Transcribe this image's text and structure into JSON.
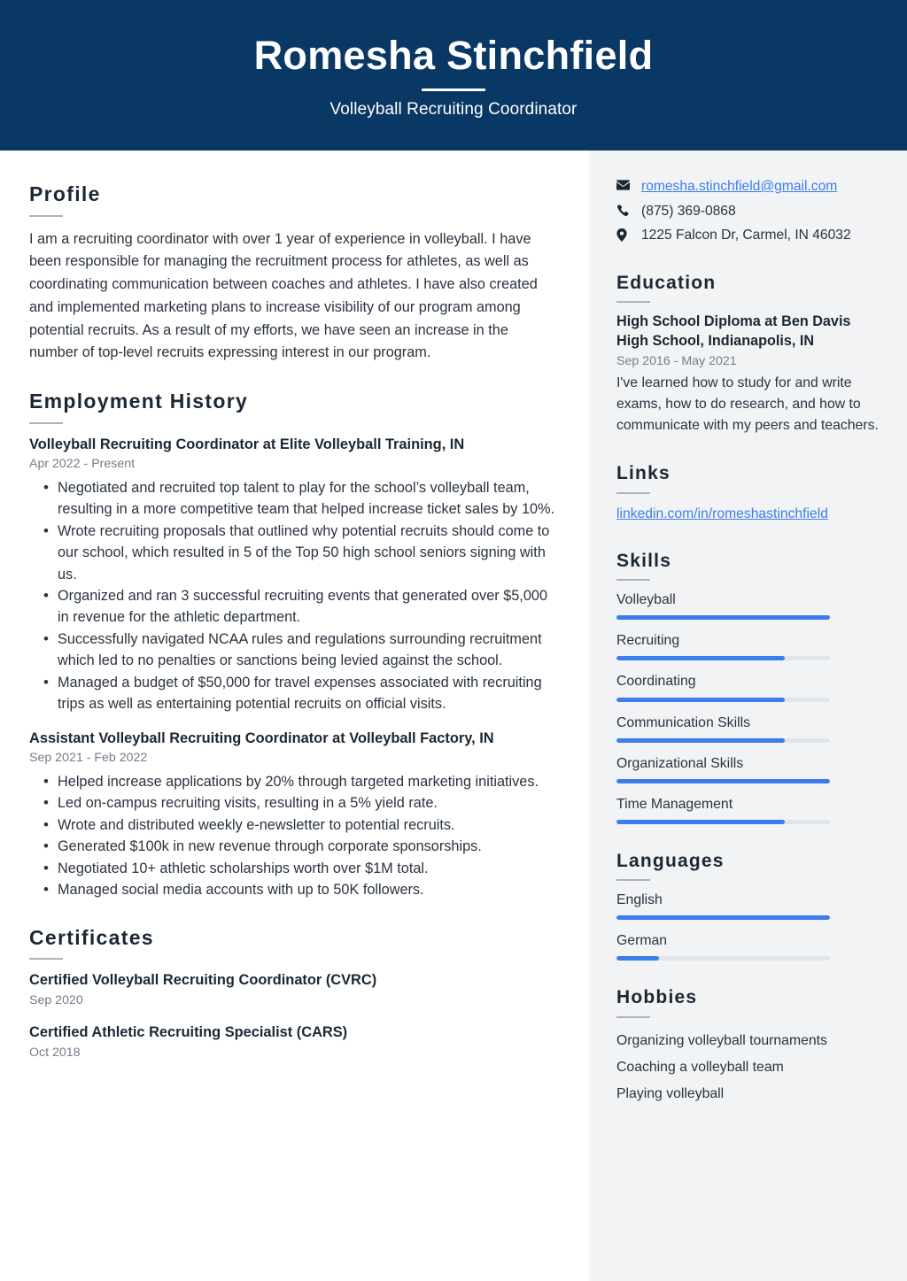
{
  "header": {
    "full_name": "Romesha Stinchfield",
    "job_title": "Volleyball Recruiting Coordinator",
    "background_color": "#0a3865",
    "text_color": "#ffffff"
  },
  "theme": {
    "accent_color": "#3b7ded",
    "sidebar_background": "#f1f3f5",
    "heading_color": "#1b2733",
    "body_text_color": "#2a3340",
    "muted_text_color": "#737d8a",
    "rule_color": "#aeb4bd",
    "track_color": "#e2e5e8"
  },
  "main": {
    "profile": {
      "heading": "Profile",
      "text": "I am a recruiting coordinator with over 1 year of experience in volleyball. I have been responsible for managing the recruitment process for athletes, as well as coordinating communication between coaches and athletes. I have also created and implemented marketing plans to increase visibility of our program among potential recruits. As a result of my efforts, we have seen an increase in the number of top-level recruits expressing interest in our program."
    },
    "employment": {
      "heading": "Employment History",
      "jobs": [
        {
          "title": "Volleyball Recruiting Coordinator at Elite Volleyball Training, IN",
          "dates": "Apr 2022 - Present",
          "bullets": [
            "Negotiated and recruited top talent to play for the school’s volleyball team, resulting in a more competitive team that helped increase ticket sales by 10%.",
            "Wrote recruiting proposals that outlined why potential recruits should come to our school, which resulted in 5 of the Top 50 high school seniors signing with us.",
            "Organized and ran 3 successful recruiting events that generated over $5,000 in revenue for the athletic department.",
            "Successfully navigated NCAA rules and regulations surrounding recruitment which led to no penalties or sanctions being levied against the school.",
            "Managed a budget of $50,000 for travel expenses associated with recruiting trips as well as entertaining potential recruits on official visits."
          ]
        },
        {
          "title": "Assistant Volleyball Recruiting Coordinator at Volleyball Factory, IN",
          "dates": "Sep 2021 - Feb 2022",
          "bullets": [
            "Helped increase applications by 20% through targeted marketing initiatives.",
            "Led on-campus recruiting visits, resulting in a 5% yield rate.",
            "Wrote and distributed weekly e-newsletter to potential recruits.",
            "Generated $100k in new revenue through corporate sponsorships.",
            "Negotiated 10+ athletic scholarships worth over $1M total.",
            "Managed social media accounts with up to 50K followers."
          ]
        }
      ]
    },
    "certificates": {
      "heading": "Certificates",
      "items": [
        {
          "name": "Certified Volleyball Recruiting Coordinator (CVRC)",
          "date": "Sep 2020"
        },
        {
          "name": "Certified Athletic Recruiting Specialist (CARS)",
          "date": "Oct 2018"
        }
      ]
    }
  },
  "sidebar": {
    "contact": [
      {
        "icon": "envelope-icon",
        "value": "romesha.stinchfield@gmail.com",
        "is_link": true
      },
      {
        "icon": "phone-icon",
        "value": "(875) 369-0868",
        "is_link": false
      },
      {
        "icon": "location-pin-icon",
        "value": "1225 Falcon Dr, Carmel, IN 46032",
        "is_link": false
      }
    ],
    "education": {
      "heading": "Education",
      "degree": "High School Diploma at Ben Davis High School, Indianapolis, IN",
      "dates": "Sep 2016 - May 2021",
      "description": "I've learned how to study for and write exams, how to do research, and how to communicate with my peers and teachers."
    },
    "links": {
      "heading": "Links",
      "items": [
        "linkedin.com/in/romeshastinchfield"
      ]
    },
    "skills": {
      "heading": "Skills",
      "items": [
        {
          "label": "Volleyball",
          "level": 100
        },
        {
          "label": "Recruiting",
          "level": 79
        },
        {
          "label": "Coordinating",
          "level": 79
        },
        {
          "label": "Communication Skills",
          "level": 79
        },
        {
          "label": "Organizational Skills",
          "level": 100
        },
        {
          "label": "Time Management",
          "level": 79
        }
      ]
    },
    "languages": {
      "heading": "Languages",
      "items": [
        {
          "label": "English",
          "level": 100
        },
        {
          "label": "German",
          "level": 20
        }
      ]
    },
    "hobbies": {
      "heading": "Hobbies",
      "items": [
        "Organizing volleyball tournaments",
        "Coaching a volleyball team",
        "Playing volleyball"
      ]
    }
  }
}
